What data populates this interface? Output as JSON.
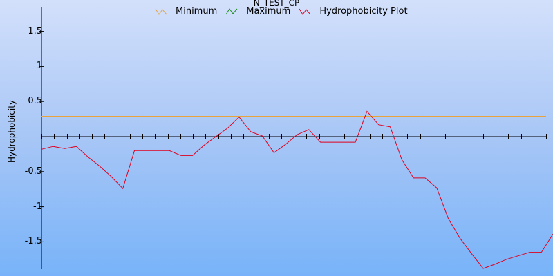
{
  "chart_data": {
    "type": "line",
    "title": "N_TEST_CP",
    "ylabel": "Hydrophobicity",
    "xlabel": "",
    "ylim": [
      -1.87,
      1.87
    ],
    "yticks": [
      1.5,
      1,
      0.5,
      -0.5,
      -1,
      -1.5
    ],
    "ytick_labels": [
      "1.5",
      "1",
      "0.5",
      "-0.5",
      "-1",
      "-1.5"
    ],
    "legend_position": "top-center",
    "grid": false,
    "n_ticks": 40,
    "series": [
      {
        "name": "Minimum",
        "color": "#e8a33c",
        "values": [
          0.29
        ]
      },
      {
        "name": "Maximum",
        "color": "#1a8a1a",
        "values": []
      },
      {
        "name": "Hydrophobicity Plot",
        "color": "#e0001e",
        "values": [
          -0.18,
          -0.14,
          -0.17,
          -0.14,
          -0.29,
          -0.42,
          -0.57,
          -0.74,
          -0.2,
          -0.2,
          -0.2,
          -0.2,
          -0.27,
          -0.27,
          -0.12,
          0.0,
          0.12,
          0.28,
          0.07,
          0.01,
          -0.23,
          -0.11,
          0.03,
          0.1,
          -0.08,
          -0.08,
          -0.08,
          -0.08,
          0.36,
          0.17,
          0.14,
          -0.33,
          -0.59,
          -0.59,
          -0.73,
          -1.17,
          -1.45,
          -1.67,
          -1.88,
          -1.82,
          -1.75,
          -1.7,
          -1.65,
          -1.65,
          -1.39
        ]
      }
    ]
  }
}
